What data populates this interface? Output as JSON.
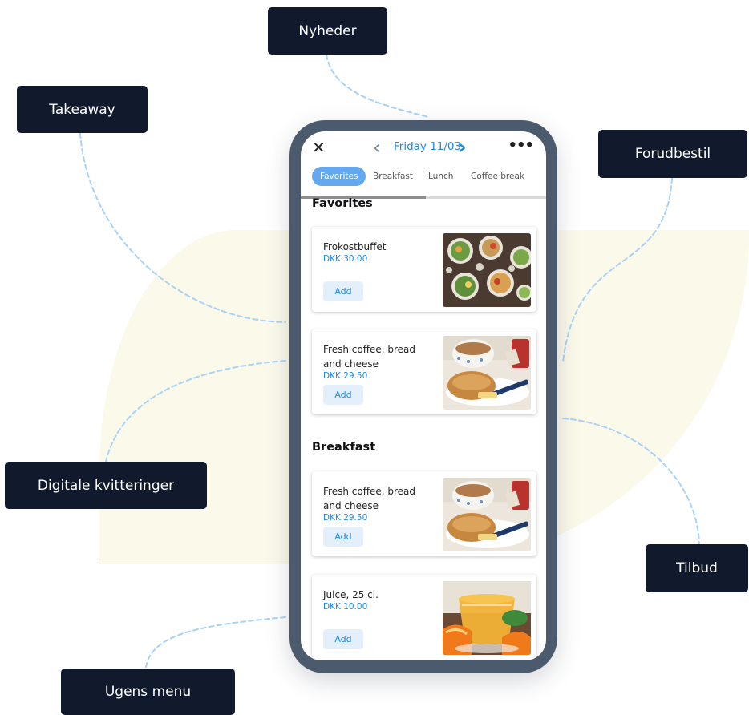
{
  "callouts": {
    "nyheder": "Nyheder",
    "takeaway": "Takeaway",
    "forudbestil": "Forudbestil",
    "digitale": "Digitale kvitteringer",
    "tilbud": "Tilbud",
    "ugens_menu": "Ugens menu"
  },
  "app": {
    "date": "Friday 11/03",
    "tabs": [
      "Favorites",
      "Breakfast",
      "Lunch",
      "Coffee break"
    ],
    "sections": {
      "favorites": "Favorites",
      "breakfast": "Breakfast"
    },
    "items": [
      {
        "name": "Frokostbuffet",
        "price": "DKK 30.00",
        "add": "Add"
      },
      {
        "name": "Fresh coffee, bread and cheese",
        "price": "DKK 29.50",
        "add": "Add"
      },
      {
        "name": "Fresh coffee, bread and cheese",
        "price": "DKK 29.50",
        "add": "Add"
      },
      {
        "name": "Juice, 25 cl.",
        "price": "DKK 10.00",
        "add": "Add"
      }
    ]
  },
  "colors": {
    "callout_bg": "#111a2c",
    "accent": "#1e88e5",
    "active_tab": "#64a9ef",
    "phone_frame": "#4b5a6d",
    "bg_shape": "#fbf9ea",
    "connector": "#a9d3f5"
  },
  "icons": {
    "close": "close-icon",
    "prev": "chevron-left-icon",
    "next": "chevron-right-icon",
    "more": "more-horizontal-icon"
  }
}
